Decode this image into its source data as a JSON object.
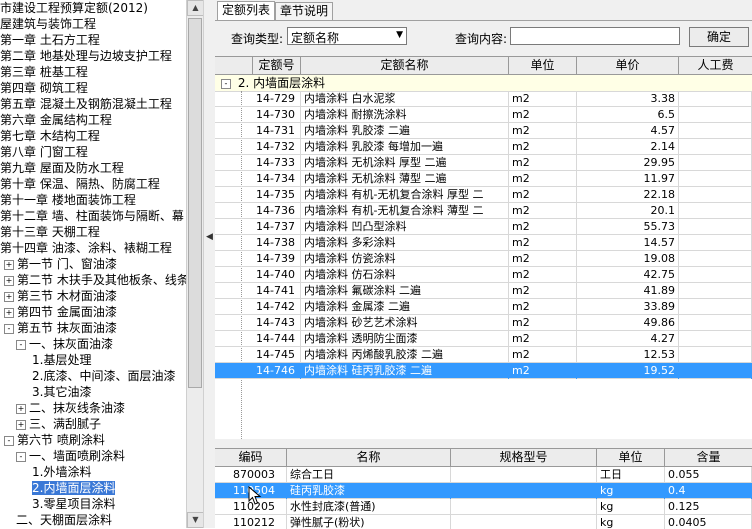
{
  "tree": {
    "items": [
      {
        "label": "市建设工程预算定额(2012)",
        "indent": 0,
        "toggle": ""
      },
      {
        "label": "屋建筑与装饰工程",
        "indent": 0,
        "toggle": ""
      },
      {
        "label": "第一章  土石方工程",
        "indent": 0,
        "toggle": ""
      },
      {
        "label": "第二章  地基处理与边坡支护工程",
        "indent": 0,
        "toggle": ""
      },
      {
        "label": "第三章  桩基工程",
        "indent": 0,
        "toggle": ""
      },
      {
        "label": "第四章  砌筑工程",
        "indent": 0,
        "toggle": ""
      },
      {
        "label": "第五章  混凝土及钢筋混凝土工程",
        "indent": 0,
        "toggle": ""
      },
      {
        "label": "第六章  金属结构工程",
        "indent": 0,
        "toggle": ""
      },
      {
        "label": "第七章  木结构工程",
        "indent": 0,
        "toggle": ""
      },
      {
        "label": "第八章  门窗工程",
        "indent": 0,
        "toggle": ""
      },
      {
        "label": "第九章  屋面及防水工程",
        "indent": 0,
        "toggle": ""
      },
      {
        "label": "第十章  保温、隔热、防腐工程",
        "indent": 0,
        "toggle": ""
      },
      {
        "label": "第十一章  楼地面装饰工程",
        "indent": 0,
        "toggle": ""
      },
      {
        "label": "第十二章  墙、柱面装饰与隔断、幕",
        "indent": 0,
        "toggle": ""
      },
      {
        "label": "第十三章  天棚工程",
        "indent": 0,
        "toggle": ""
      },
      {
        "label": "第十四章  油漆、涂料、裱糊工程",
        "indent": 0,
        "toggle": ""
      },
      {
        "label": "第一节  门、窗油漆",
        "indent": 1,
        "toggle": "+"
      },
      {
        "label": "第二节  木扶手及其他板条、线条",
        "indent": 1,
        "toggle": "+"
      },
      {
        "label": "第三节  木材面油漆",
        "indent": 1,
        "toggle": "+"
      },
      {
        "label": "第四节  金属面油漆",
        "indent": 1,
        "toggle": "+"
      },
      {
        "label": "第五节  抹灰面油漆",
        "indent": 1,
        "toggle": "-"
      },
      {
        "label": "一、抹灰面油漆",
        "indent": 2,
        "toggle": "-"
      },
      {
        "label": "1.基层处理",
        "indent": 3,
        "toggle": ""
      },
      {
        "label": "2.底漆、中间漆、面层油漆",
        "indent": 3,
        "toggle": ""
      },
      {
        "label": "3.其它油漆",
        "indent": 3,
        "toggle": ""
      },
      {
        "label": "二、抹灰线条油漆",
        "indent": 2,
        "toggle": "+"
      },
      {
        "label": "三、满刮腻子",
        "indent": 2,
        "toggle": "+"
      },
      {
        "label": "第六节  喷刷涂料",
        "indent": 1,
        "toggle": "-"
      },
      {
        "label": "一、墙面喷刷涂料",
        "indent": 2,
        "toggle": "-"
      },
      {
        "label": "1.外墙涂料",
        "indent": 3,
        "toggle": ""
      },
      {
        "label": "2.内墙面层涂料",
        "indent": 3,
        "toggle": "",
        "selected": true
      },
      {
        "label": "3.零星项目涂料",
        "indent": 3,
        "toggle": ""
      },
      {
        "label": "二、天棚面层涂料",
        "indent": 2,
        "toggle": ""
      }
    ]
  },
  "tabs": [
    {
      "label": "定额列表",
      "active": true
    },
    {
      "label": "章节说明",
      "active": false
    }
  ],
  "query": {
    "type_label": "查询类型:",
    "type_value": "定额名称",
    "content_label": "查询内容:",
    "content_value": "",
    "confirm_label": "确定"
  },
  "quota_table": {
    "headers": [
      "定额号",
      "定额名称",
      "单位",
      "单价",
      "人工费"
    ],
    "group": "2. 内墙面层涂料",
    "rows": [
      {
        "code": "14-729",
        "name": "内墙涂料  白水泥浆",
        "unit": "m2",
        "price": "3.38"
      },
      {
        "code": "14-730",
        "name": "内墙涂料  耐擦洗涂料",
        "unit": "m2",
        "price": "6.5"
      },
      {
        "code": "14-731",
        "name": "内墙涂料  乳胶漆  二遍",
        "unit": "m2",
        "price": "4.57"
      },
      {
        "code": "14-732",
        "name": "内墙涂料  乳胶漆  每增加一遍",
        "unit": "m2",
        "price": "2.14"
      },
      {
        "code": "14-733",
        "name": "内墙涂料  无机涂料  厚型  二遍",
        "unit": "m2",
        "price": "29.95"
      },
      {
        "code": "14-734",
        "name": "内墙涂料  无机涂料  薄型  二遍",
        "unit": "m2",
        "price": "11.97"
      },
      {
        "code": "14-735",
        "name": "内墙涂料  有机-无机复合涂料  厚型  二",
        "unit": "m2",
        "price": "22.18"
      },
      {
        "code": "14-736",
        "name": "内墙涂料  有机-无机复合涂料  薄型  二",
        "unit": "m2",
        "price": "20.1"
      },
      {
        "code": "14-737",
        "name": "内墙涂料  凹凸型涂料",
        "unit": "m2",
        "price": "55.73"
      },
      {
        "code": "14-738",
        "name": "内墙涂料  多彩涂料",
        "unit": "m2",
        "price": "14.57"
      },
      {
        "code": "14-739",
        "name": "内墙涂料  仿瓷涂料",
        "unit": "m2",
        "price": "19.08"
      },
      {
        "code": "14-740",
        "name": "内墙涂料  仿石涂料",
        "unit": "m2",
        "price": "42.75"
      },
      {
        "code": "14-741",
        "name": "内墙涂料  氟碳涂料  二遍",
        "unit": "m2",
        "price": "41.89"
      },
      {
        "code": "14-742",
        "name": "内墙涂料  金属漆  二遍",
        "unit": "m2",
        "price": "33.89"
      },
      {
        "code": "14-743",
        "name": "内墙涂料  砂艺艺术涂料",
        "unit": "m2",
        "price": "49.86"
      },
      {
        "code": "14-744",
        "name": "内墙涂料  透明防尘面漆",
        "unit": "m2",
        "price": "4.27"
      },
      {
        "code": "14-745",
        "name": "内墙涂料  丙烯酸乳胶漆  二遍",
        "unit": "m2",
        "price": "12.53"
      },
      {
        "code": "14-746",
        "name": "内墙涂料  硅丙乳胶漆  二遍",
        "unit": "m2",
        "price": "19.52",
        "selected": true
      }
    ]
  },
  "material_table": {
    "headers": [
      "编码",
      "名称",
      "规格型号",
      "单位",
      "含量"
    ],
    "rows": [
      {
        "code": "870003",
        "name": "综合工日",
        "spec": "",
        "unit": "工日",
        "qty": "0.055"
      },
      {
        "code": "110504",
        "name": "硅丙乳胶漆",
        "spec": "",
        "unit": "kg",
        "qty": "0.4",
        "selected": true
      },
      {
        "code": "110205",
        "name": "水性封底漆(普通)",
        "spec": "",
        "unit": "kg",
        "qty": "0.125"
      },
      {
        "code": "110212",
        "name": "弹性腻子(粉状)",
        "spec": "",
        "unit": "kg",
        "qty": "0.0405"
      }
    ]
  }
}
